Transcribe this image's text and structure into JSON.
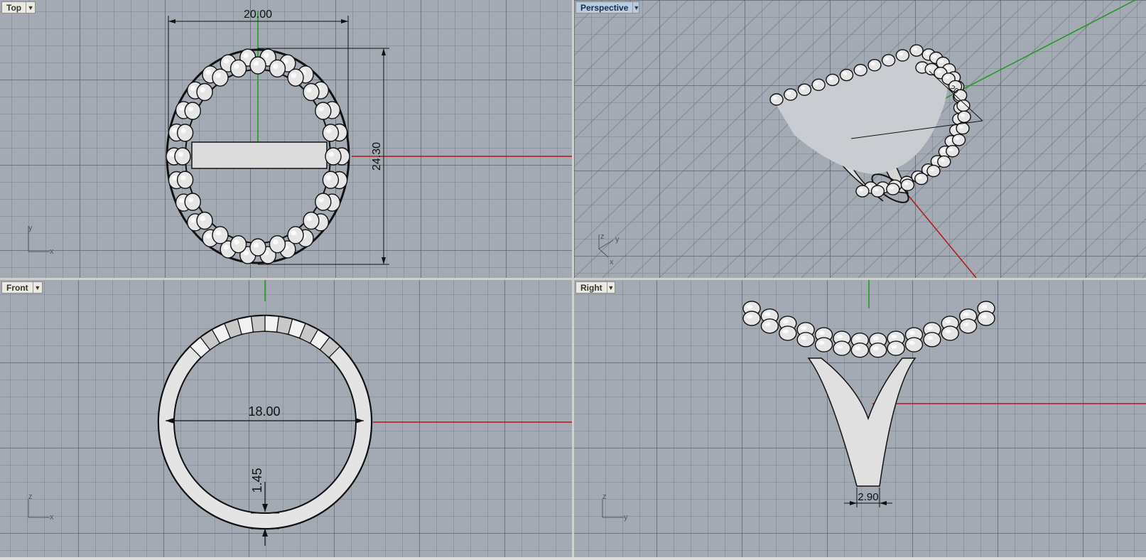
{
  "viewports": {
    "top": {
      "label": "Top",
      "active": false,
      "dims": [
        "20.00",
        "24.30"
      ],
      "axes": [
        "y",
        "x"
      ]
    },
    "perspective": {
      "label": "Perspective",
      "active": true,
      "dims": [
        "20"
      ],
      "axes": [
        "z",
        "y",
        "x"
      ]
    },
    "front": {
      "label": "Front",
      "active": false,
      "dims": [
        "18.00",
        "1.45"
      ],
      "axes": [
        "z",
        "x"
      ]
    },
    "right": {
      "label": "Right",
      "active": false,
      "dims": [
        "2.90"
      ],
      "axes": [
        "z",
        "y"
      ]
    }
  },
  "colors": {
    "grid_bg": "#a3aab3",
    "x_axis": "#b01818",
    "y_axis": "#1c9b1c",
    "model_fill": "#e2e2e2",
    "model_outline": "#111111",
    "active_tab": "#b8cce6"
  },
  "icons": {
    "viewport_menu": "chevron-down-icon"
  }
}
